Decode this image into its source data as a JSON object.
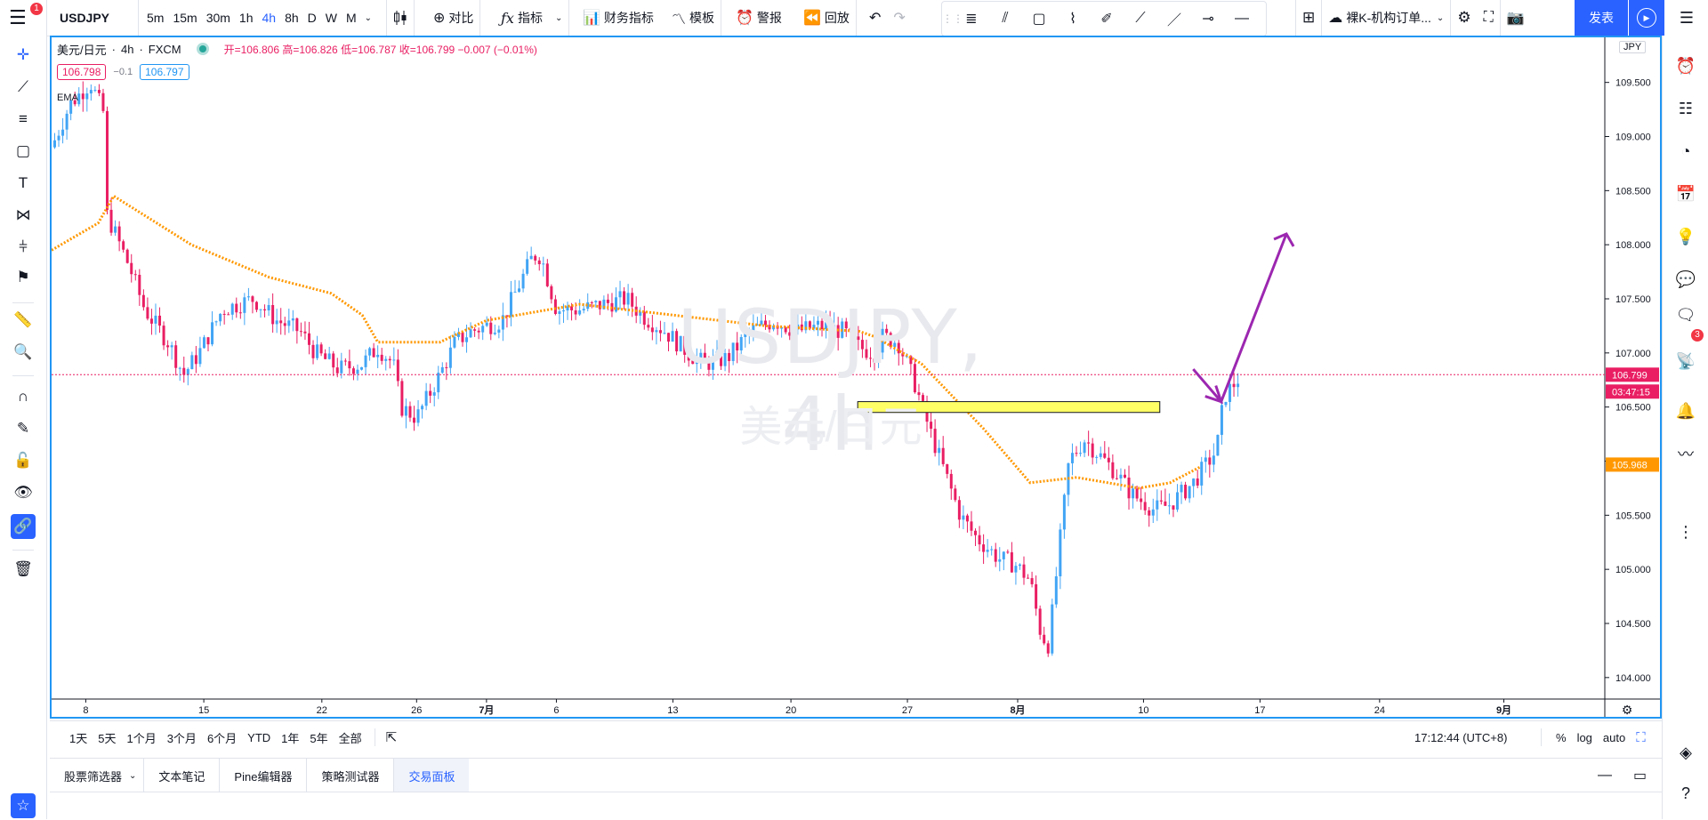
{
  "topbar": {
    "symbol": "USDJPY",
    "menu_badge": "1",
    "intervals": [
      "5m",
      "15m",
      "30m",
      "1h",
      "4h",
      "8h",
      "D",
      "W",
      "M"
    ],
    "active_interval": "4h",
    "compare_label": "对比",
    "indicators_label": "指标",
    "financials_label": "财务指标",
    "templates_label": "模板",
    "alert_label": "警报",
    "replay_label": "回放",
    "layout_name": "裸K-机构订单...",
    "publish_label": "发表"
  },
  "legend": {
    "title": "美元/日元",
    "interval": "4h",
    "exchange": "FXCM",
    "ohlc_text": "开=106.806 高=106.826 低=106.787 收=106.799 −0.007 (−0.01%)",
    "bid": "106.798",
    "spread": "−0.1",
    "ask": "106.797",
    "ema_label": "EMA"
  },
  "watermark": {
    "symbol": "USDJPY, 4h",
    "name": "美元/日元"
  },
  "price_axis": {
    "currency": "JPY",
    "labels": [
      "109.500",
      "109.000",
      "108.500",
      "108.000",
      "107.500",
      "107.000",
      "106.500",
      "106.000",
      "105.500",
      "105.000",
      "104.500",
      "104.000"
    ],
    "last_price": "106.799",
    "countdown": "03:47:15",
    "ema_price": "105.968"
  },
  "time_axis": {
    "labels": [
      "8",
      "15",
      "22",
      "26",
      "7月",
      "6",
      "13",
      "20",
      "27",
      "8月",
      "10",
      "17",
      "24",
      "9月"
    ]
  },
  "chart_data": {
    "type": "candlestick",
    "symbol": "USDJPY",
    "interval": "4h",
    "ylim": [
      103.9,
      109.9
    ],
    "last": 106.799,
    "ema_last": 105.968,
    "ema_path": [
      [
        -0.0,
        107.95
      ],
      [
        0.03,
        108.2
      ],
      [
        0.04,
        108.45
      ],
      [
        0.09,
        108.0
      ],
      [
        0.14,
        107.7
      ],
      [
        0.18,
        107.55
      ],
      [
        0.2,
        107.35
      ],
      [
        0.21,
        107.1
      ],
      [
        0.25,
        107.1
      ],
      [
        0.28,
        107.3
      ],
      [
        0.34,
        107.45
      ],
      [
        0.37,
        107.4
      ],
      [
        0.46,
        107.25
      ],
      [
        0.52,
        107.2
      ],
      [
        0.53,
        107.15
      ],
      [
        0.56,
        106.9
      ],
      [
        0.6,
        106.3
      ],
      [
        0.63,
        105.8
      ],
      [
        0.66,
        105.85
      ],
      [
        0.68,
        105.8
      ],
      [
        0.7,
        105.75
      ],
      [
        0.72,
        105.8
      ],
      [
        0.74,
        105.95
      ]
    ],
    "highlight_zone": {
      "top": 106.55,
      "bottom": 106.45
    },
    "arrow_path": [
      [
        0.735,
        106.85
      ],
      [
        0.753,
        106.55
      ],
      [
        0.795,
        108.1
      ]
    ],
    "colors": {
      "up": "#42a5f5",
      "down": "#e91e63",
      "ema": "#ff9800",
      "arrow": "#9c27b0",
      "zone": "#ffff66"
    }
  },
  "range_bar": {
    "ranges": [
      "1天",
      "5天",
      "1个月",
      "3个月",
      "6个月",
      "YTD",
      "1年",
      "5年",
      "全部"
    ],
    "clock": "17:12:44 (UTC+8)",
    "percent": "%",
    "log": "log",
    "auto": "auto"
  },
  "panel_tabs": {
    "tabs": [
      "股票筛选器",
      "文本笔记",
      "Pine编辑器",
      "策略测试器",
      "交易面板"
    ],
    "active": "交易面板"
  },
  "right_badge": "3"
}
